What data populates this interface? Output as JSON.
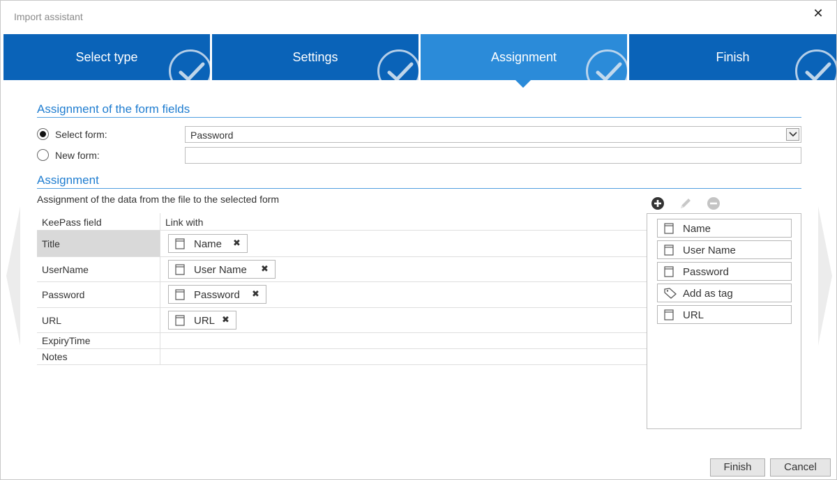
{
  "window": {
    "title": "Import assistant",
    "close_icon": "close-icon"
  },
  "steps": [
    {
      "label": "Select type",
      "state": "done"
    },
    {
      "label": "Settings",
      "state": "done"
    },
    {
      "label": "Assignment",
      "state": "active"
    },
    {
      "label": "Finish",
      "state": "done"
    }
  ],
  "form_fields": {
    "section_title": "Assignment of the form fields",
    "select_form_label": "Select form:",
    "select_form_value": "Password",
    "new_form_label": "New form:",
    "new_form_value": "",
    "selected_option": "select_form"
  },
  "assignment": {
    "section_title": "Assignment",
    "subtitle": "Assignment of the data from the file to the selected form",
    "columns": [
      "KeePass field",
      "Link with"
    ],
    "rows": [
      {
        "field": "Title",
        "link": "Name",
        "selected": true
      },
      {
        "field": "UserName",
        "link": "User Name"
      },
      {
        "field": "Password",
        "link": "Password"
      },
      {
        "field": "URL",
        "link": "URL"
      },
      {
        "field": "ExpiryTime",
        "link": ""
      },
      {
        "field": "Notes",
        "link": ""
      }
    ],
    "remove_glyph": "✖"
  },
  "palette": {
    "toolbar": [
      "add-icon",
      "edit-icon",
      "remove-icon"
    ],
    "items": [
      {
        "label": "Name",
        "icon": "field-icon"
      },
      {
        "label": "User Name",
        "icon": "field-icon"
      },
      {
        "label": "Password",
        "icon": "field-icon"
      },
      {
        "label": "Add as tag",
        "icon": "tag-icon"
      },
      {
        "label": "URL",
        "icon": "field-icon"
      }
    ]
  },
  "footer": {
    "finish_label": "Finish",
    "cancel_label": "Cancel"
  },
  "colors": {
    "step_bg": "#0a63b8",
    "step_active_bg": "#2b8bd9",
    "section_title": "#1f7dd0"
  }
}
